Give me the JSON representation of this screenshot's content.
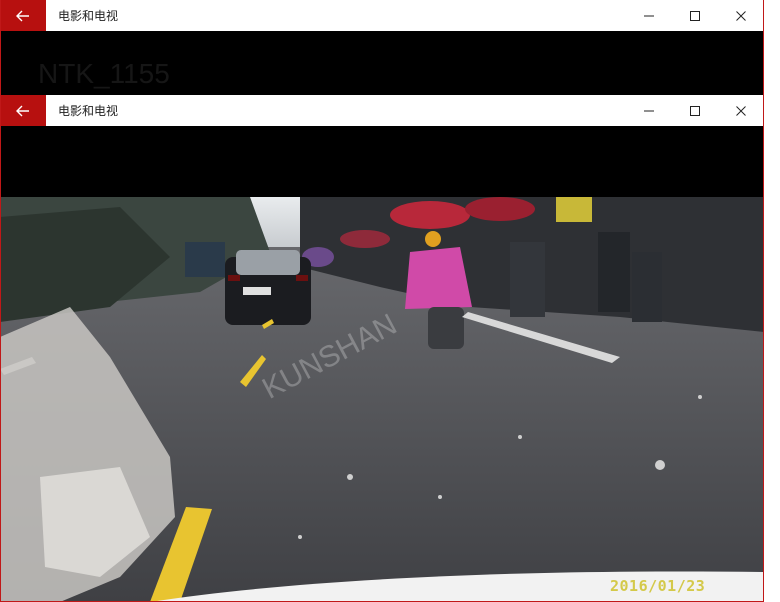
{
  "window_back": {
    "title": "电影和电视"
  },
  "window_front": {
    "title": "电影和电视"
  },
  "background_title": "NTK_1155",
  "video": {
    "timestamp": "2016/01/23",
    "watermark": "KUNSHAN"
  },
  "icons": {
    "back": "arrow-left-icon",
    "minimize": "minimize-icon",
    "maximize": "maximize-icon",
    "close": "close-icon"
  },
  "colors": {
    "accent": "#b7100f",
    "titlebar": "#ffffff",
    "background": "#000000",
    "timestamp": "#d4c94a"
  }
}
